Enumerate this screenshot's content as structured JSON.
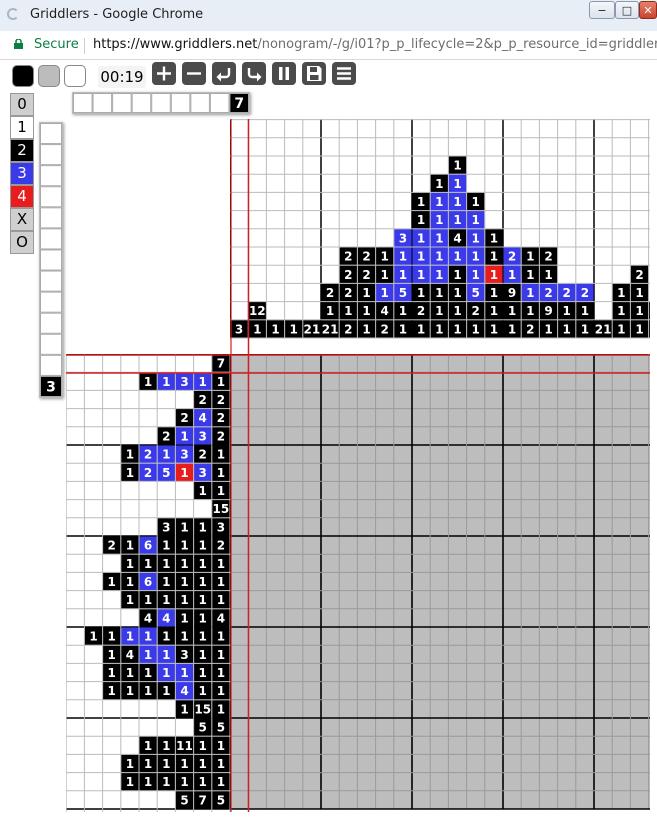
{
  "browser": {
    "tab_title": "Griddlers - Google Chrome",
    "minimize_label": "−",
    "maximize_label": "□",
    "close_label": "✕",
    "secure_label": "Secure",
    "url_main": "https://www.griddlers.net",
    "url_rest": "/nonogram/-/g/i01?p_p_lifecycle=2&p_p_resource_id=griddler..."
  },
  "toolbar": {
    "timer": "00:19",
    "color_swatches": [
      "#000000",
      "#bcbcbc",
      "#ffffff"
    ],
    "buttons": [
      "zoom-in",
      "zoom-out",
      "undo",
      "redo",
      "pause",
      "save",
      "menu"
    ]
  },
  "palette": [
    {
      "label": "0",
      "bg": "#cfcfcf",
      "fg": "#000000"
    },
    {
      "label": "1",
      "bg": "#ffffff",
      "fg": "#000000"
    },
    {
      "label": "2",
      "bg": "#000000",
      "fg": "#ffffff"
    },
    {
      "label": "3",
      "bg": "#3a3ae8",
      "fg": "#ffffff"
    },
    {
      "label": "4",
      "bg": "#e81c1c",
      "fg": "#ffffff"
    },
    {
      "label": "X",
      "bg": "#cfcfcf",
      "fg": "#000000"
    },
    {
      "label": "O",
      "bg": "#cfcfcf",
      "fg": "#000000"
    }
  ],
  "row_tool": {
    "cells": 9,
    "value": "7"
  },
  "col_tool": {
    "cells": 13,
    "value": "3"
  },
  "colors": {
    "1": "#000000",
    "2": "#3a3ae8",
    "3": "#e81c1c",
    "board": "#bdbdbd"
  },
  "column_clues": [
    [
      [
        3,
        1
      ]
    ],
    [
      [
        12,
        1
      ],
      [
        1,
        1
      ]
    ],
    [
      [
        1,
        1
      ]
    ],
    [
      [
        1,
        1
      ]
    ],
    [
      [
        21,
        1
      ]
    ],
    [
      [
        2,
        1
      ],
      [
        1,
        1
      ],
      [
        21,
        1
      ]
    ],
    [
      [
        2,
        1
      ],
      [
        2,
        1
      ],
      [
        2,
        1
      ],
      [
        1,
        1
      ],
      [
        2,
        1
      ]
    ],
    [
      [
        2,
        1
      ],
      [
        2,
        1
      ],
      [
        1,
        1
      ],
      [
        1,
        1
      ],
      [
        1,
        1
      ]
    ],
    [
      [
        1,
        1
      ],
      [
        1,
        1
      ],
      [
        1,
        2
      ],
      [
        4,
        1
      ],
      [
        2,
        1
      ]
    ],
    [
      [
        3,
        2
      ],
      [
        1,
        2
      ],
      [
        1,
        2
      ],
      [
        5,
        2
      ],
      [
        1,
        1
      ],
      [
        1,
        1
      ]
    ],
    [
      [
        1,
        1
      ],
      [
        1,
        1
      ],
      [
        1,
        2
      ],
      [
        1,
        2
      ],
      [
        1,
        2
      ],
      [
        1,
        1
      ],
      [
        2,
        1
      ],
      [
        1,
        1
      ]
    ],
    [
      [
        1,
        1
      ],
      [
        1,
        2
      ],
      [
        1,
        2
      ],
      [
        1,
        2
      ],
      [
        1,
        2
      ],
      [
        1,
        2
      ],
      [
        1,
        1
      ],
      [
        1,
        1
      ],
      [
        1,
        1
      ]
    ],
    [
      [
        1,
        1
      ],
      [
        1,
        2
      ],
      [
        1,
        2
      ],
      [
        1,
        2
      ],
      [
        4,
        1
      ],
      [
        1,
        2
      ],
      [
        1,
        1
      ],
      [
        1,
        1
      ],
      [
        1,
        1
      ],
      [
        1,
        1
      ]
    ],
    [
      [
        1,
        1
      ],
      [
        1,
        2
      ],
      [
        1,
        2
      ],
      [
        1,
        2
      ],
      [
        1,
        2
      ],
      [
        5,
        2
      ],
      [
        2,
        1
      ],
      [
        1,
        1
      ]
    ],
    [
      [
        1,
        1
      ],
      [
        1,
        1
      ],
      [
        1,
        3
      ],
      [
        1,
        1
      ],
      [
        1,
        1
      ],
      [
        1,
        1
      ]
    ],
    [
      [
        2,
        2
      ],
      [
        1,
        2
      ],
      [
        9,
        1
      ],
      [
        1,
        1
      ],
      [
        1,
        1
      ]
    ],
    [
      [
        1,
        1
      ],
      [
        1,
        1
      ],
      [
        1,
        2
      ],
      [
        1,
        1
      ],
      [
        2,
        1
      ]
    ],
    [
      [
        2,
        1
      ],
      [
        1,
        1
      ],
      [
        2,
        2
      ],
      [
        9,
        1
      ],
      [
        1,
        1
      ]
    ],
    [
      [
        2,
        2
      ],
      [
        1,
        1
      ],
      [
        1,
        1
      ]
    ],
    [
      [
        2,
        2
      ],
      [
        1,
        1
      ],
      [
        1,
        1
      ]
    ],
    [
      [
        21,
        1
      ]
    ],
    [
      [
        1,
        1
      ],
      [
        1,
        1
      ],
      [
        1,
        1
      ]
    ],
    [
      [
        2,
        1
      ],
      [
        1,
        1
      ],
      [
        1,
        1
      ],
      [
        1,
        1
      ]
    ],
    [
      [
        1,
        1
      ],
      [
        1,
        1
      ]
    ],
    [
      [
        1,
        1
      ],
      [
        3,
        1
      ]
    ]
  ],
  "row_clues": [
    [
      [
        7,
        1
      ]
    ],
    [
      [
        1,
        1
      ],
      [
        1,
        2
      ],
      [
        3,
        2
      ],
      [
        1,
        2
      ],
      [
        1,
        1
      ]
    ],
    [
      [
        2,
        1
      ],
      [
        2,
        1
      ]
    ],
    [
      [
        2,
        1
      ],
      [
        4,
        2
      ],
      [
        2,
        1
      ]
    ],
    [
      [
        2,
        1
      ],
      [
        1,
        2
      ],
      [
        3,
        2
      ],
      [
        2,
        1
      ]
    ],
    [
      [
        1,
        1
      ],
      [
        2,
        2
      ],
      [
        1,
        2
      ],
      [
        3,
        2
      ],
      [
        2,
        1
      ],
      [
        1,
        1
      ]
    ],
    [
      [
        1,
        1
      ],
      [
        2,
        2
      ],
      [
        5,
        2
      ],
      [
        1,
        3
      ],
      [
        3,
        2
      ],
      [
        1,
        1
      ]
    ],
    [
      [
        1,
        1
      ],
      [
        1,
        1
      ]
    ],
    [
      [
        15,
        1
      ]
    ],
    [
      [
        3,
        1
      ],
      [
        1,
        1
      ],
      [
        1,
        1
      ],
      [
        3,
        1
      ]
    ],
    [
      [
        2,
        1
      ],
      [
        1,
        1
      ],
      [
        6,
        2
      ],
      [
        1,
        1
      ],
      [
        1,
        1
      ],
      [
        1,
        1
      ],
      [
        2,
        1
      ]
    ],
    [
      [
        1,
        1
      ],
      [
        1,
        1
      ],
      [
        1,
        1
      ],
      [
        1,
        1
      ],
      [
        1,
        1
      ],
      [
        1,
        1
      ]
    ],
    [
      [
        1,
        1
      ],
      [
        1,
        1
      ],
      [
        6,
        2
      ],
      [
        1,
        1
      ],
      [
        1,
        1
      ],
      [
        1,
        1
      ],
      [
        1,
        1
      ]
    ],
    [
      [
        1,
        1
      ],
      [
        1,
        1
      ],
      [
        1,
        1
      ],
      [
        1,
        1
      ],
      [
        1,
        1
      ],
      [
        1,
        1
      ]
    ],
    [
      [
        4,
        1
      ],
      [
        4,
        2
      ],
      [
        1,
        1
      ],
      [
        1,
        1
      ],
      [
        4,
        1
      ]
    ],
    [
      [
        1,
        1
      ],
      [
        1,
        1
      ],
      [
        1,
        2
      ],
      [
        1,
        2
      ],
      [
        1,
        1
      ],
      [
        1,
        1
      ],
      [
        1,
        1
      ],
      [
        1,
        1
      ]
    ],
    [
      [
        1,
        1
      ],
      [
        4,
        1
      ],
      [
        1,
        2
      ],
      [
        1,
        2
      ],
      [
        3,
        1
      ],
      [
        1,
        1
      ],
      [
        1,
        1
      ]
    ],
    [
      [
        1,
        1
      ],
      [
        1,
        1
      ],
      [
        1,
        1
      ],
      [
        1,
        2
      ],
      [
        1,
        2
      ],
      [
        1,
        1
      ],
      [
        1,
        1
      ]
    ],
    [
      [
        1,
        1
      ],
      [
        1,
        1
      ],
      [
        1,
        1
      ],
      [
        1,
        1
      ],
      [
        4,
        2
      ],
      [
        1,
        1
      ],
      [
        1,
        1
      ]
    ],
    [
      [
        1,
        1
      ],
      [
        15,
        1
      ],
      [
        1,
        1
      ]
    ],
    [
      [
        5,
        1
      ],
      [
        5,
        1
      ]
    ],
    [
      [
        1,
        1
      ],
      [
        1,
        1
      ],
      [
        11,
        1
      ],
      [
        1,
        1
      ],
      [
        1,
        1
      ]
    ],
    [
      [
        1,
        1
      ],
      [
        1,
        1
      ],
      [
        1,
        1
      ],
      [
        1,
        1
      ],
      [
        1,
        1
      ],
      [
        1,
        1
      ]
    ],
    [
      [
        1,
        1
      ],
      [
        1,
        1
      ],
      [
        1,
        1
      ],
      [
        1,
        1
      ],
      [
        1,
        1
      ],
      [
        1,
        1
      ]
    ],
    [
      [
        5,
        1
      ],
      [
        7,
        1
      ],
      [
        5,
        1
      ]
    ]
  ]
}
